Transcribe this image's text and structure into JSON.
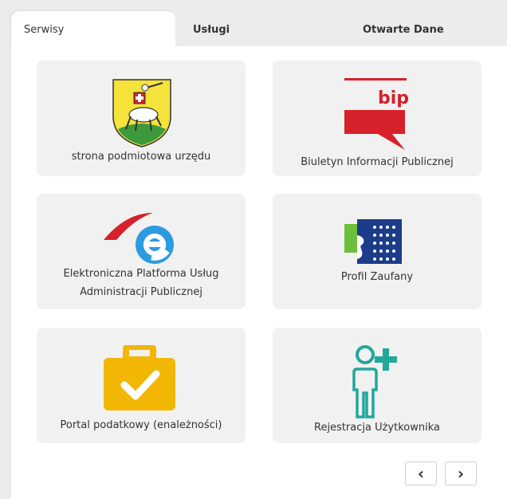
{
  "tabs": [
    {
      "label": "Serwisy"
    },
    {
      "label": "Usługi"
    },
    {
      "label": "Otwarte Dane"
    }
  ],
  "cards": [
    {
      "label": "strona podmiotowa urzędu",
      "icon": "coat-of-arms-icon"
    },
    {
      "label": "Biuletyn Informacji Publicznej",
      "icon": "bip-logo-icon",
      "logo_text": "bip"
    },
    {
      "label_line1": "Elektroniczna Platforma Usług",
      "label_line2": "Administracji Publicznej",
      "icon": "epuap-logo-icon"
    },
    {
      "label": "Profil Zaufany",
      "icon": "profil-zaufany-icon"
    },
    {
      "label": "Portal podatkowy (enależności)",
      "icon": "briefcase-check-icon"
    },
    {
      "label": "Rejestracja Użytkownika",
      "icon": "user-add-icon"
    }
  ],
  "pagination": {
    "prev": "‹",
    "next": "›"
  },
  "colors": {
    "bip_red": "#d6202a",
    "epuap_blue": "#2d9be0",
    "briefcase_yellow": "#f2b705",
    "teal": "#22a89a"
  }
}
